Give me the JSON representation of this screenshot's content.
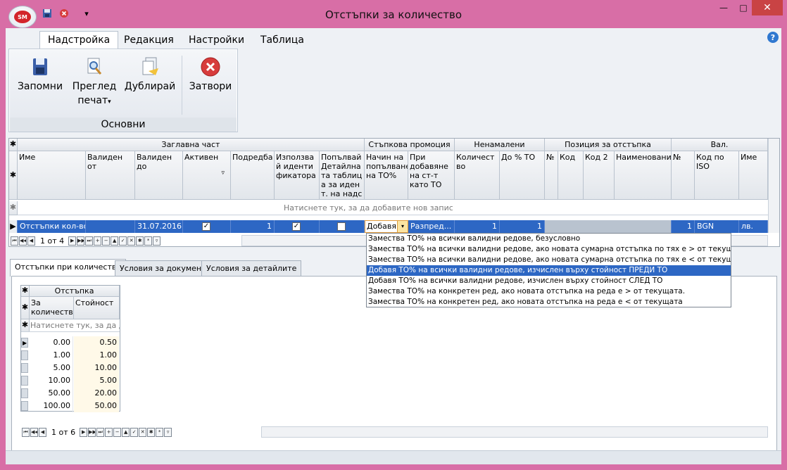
{
  "window": {
    "title": "Отстъпки за количество",
    "orb_label": "SM",
    "minimize_glyph": "—",
    "maximize_glyph": "□",
    "close_glyph": "✕",
    "qat_dropdown_glyph": "▾"
  },
  "ribbon": {
    "tabs": [
      "Надстройка",
      "Редакция",
      "Настройки",
      "Таблица"
    ],
    "help_glyph": "?",
    "buttons": [
      {
        "label": "Запомни",
        "icon": "save-icon"
      },
      {
        "label": "Преглед",
        "label2": "печат",
        "arrow": "▾",
        "icon": "print-preview-icon"
      },
      {
        "label": "Дублирай",
        "icon": "duplicate-icon"
      },
      {
        "label": "Затвори",
        "icon": "close-circle-icon"
      }
    ],
    "group_label": "Основни"
  },
  "grid1": {
    "bands": {
      "header": "Заглавна част",
      "step": "Стъпкова промоция",
      "nonreduced": "Ненамалени позиции ...",
      "position": "Позиция за отстъпка",
      "currency": "Вал."
    },
    "columns": {
      "name": "Име",
      "valid_from": "Валиден от",
      "valid_to": "Валиден до",
      "active": "Активен",
      "order": "Подредба",
      "use_ident": "Използвай идентификатора",
      "fill_detail": "Попълвай Детайлната таблица за идент. на надстр.",
      "fill_method": "Начин на попълване на ТО%",
      "add_st": "При добавяне на ст-т като ТО",
      "qty": "Количество",
      "to_pct": "До % ТО",
      "num": "№",
      "code": "Код",
      "code2": "Код 2",
      "naming": "Наименование",
      "cur_num": "№",
      "iso": "Код по ISO",
      "cur_name": "Име"
    },
    "filter_glyph": "▿",
    "new_row_text": "Натиснете тук, за да добавите нов запис",
    "row": {
      "name": "Отстъпки кол-во",
      "valid_from": "",
      "valid_to": "31.07.2016",
      "active": true,
      "order": "1",
      "use_ident": true,
      "fill_detail": false,
      "fill_method": "Добавя",
      "add_st": "Разпред...",
      "qty": "1",
      "to_pct": "1",
      "cur_num": "1",
      "iso": "BGN",
      "cur_name": "лв."
    },
    "nav_text": "1 от 4"
  },
  "dropdown": {
    "options": [
      "Замества ТО% на всички валидни редове, безусловно",
      "Замества ТО% на всички валидни редове, ако новата сумарна отстъпка по тях е > от текущата им",
      "Замества ТО% на всички валидни редове, ако новата сумарна отстъпка по тях е < от текущата им",
      "Добавя ТО% на всички валидни редове, изчислен върху стойност ПРЕДИ ТО",
      "Добавя ТО% на всички валидни редове, изчислен върху стойност СЛЕД ТО",
      "Замества ТО% на конкретен ред, ако новата отстъпка на реда е > от текущата.",
      "Замества ТО% на конкретен ред, ако новата отстъпка на реда е < от текущата"
    ],
    "selected_index": 3
  },
  "panel": {
    "tabs": [
      "Отстъпки при количество",
      "Условия за документа",
      "Условия за детайлите"
    ],
    "grid": {
      "band": "Отстъпка",
      "col_qty": "За количество",
      "col_value": "Стойност",
      "new_row_text": "Натиснете тук, за да доб",
      "rows": [
        [
          "0.00",
          "0.50"
        ],
        [
          "1.00",
          "1.00"
        ],
        [
          "5.00",
          "10.00"
        ],
        [
          "10.00",
          "5.00"
        ],
        [
          "50.00",
          "20.00"
        ],
        [
          "100.00",
          "50.00"
        ]
      ]
    },
    "nav_text": "1 от 6"
  },
  "nav_glyphs": {
    "first": "⏮",
    "prev_page": "◀◀",
    "prev": "◀",
    "next": "▶",
    "next_page": "▶▶",
    "last": "⏭",
    "add": "+",
    "delete": "−",
    "up": "▲",
    "accept": "✓",
    "cancel": "✕",
    "star1": "✱",
    "star2": "*",
    "filter": "▿"
  },
  "colors": {
    "title_bar": "#d86ea6",
    "selection": "#2d67c4",
    "dropdown_btn": "#fbe4a2"
  }
}
